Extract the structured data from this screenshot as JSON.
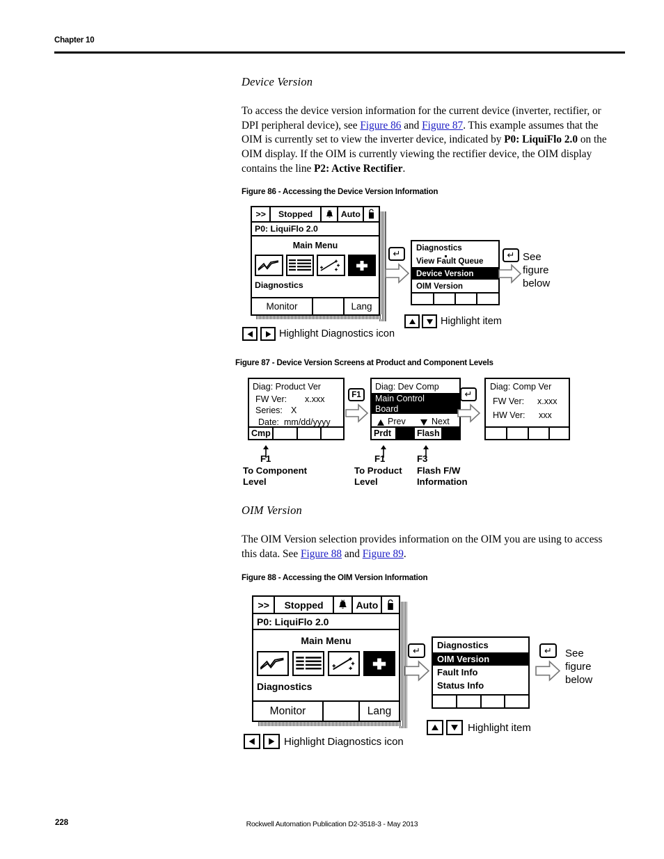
{
  "page": {
    "chapter": "Chapter 10",
    "page_number": "228",
    "publication": "Rockwell Automation Publication D2-3518-3 - May 2013"
  },
  "sections": {
    "device_version": {
      "heading": "Device Version",
      "paragraph_parts": [
        {
          "t": "To access the device version information for the current device (inverter, rectifier, or DPI peripheral device), see "
        },
        {
          "t": "Figure 86",
          "style": "link"
        },
        {
          "t": " and "
        },
        {
          "t": "Figure 87",
          "style": "link"
        },
        {
          "t": ". This example assumes that the OIM is currently set to view the inverter device, indicated by "
        },
        {
          "t": "P0: LiquiFlo 2.0",
          "style": "bold"
        },
        {
          "t": " on the OIM display. If the OIM is currently viewing the rectifier device, the OIM display contains the line "
        },
        {
          "t": "P2: Active Rectifier",
          "style": "bold"
        },
        {
          "t": "."
        }
      ]
    },
    "oim_version": {
      "heading": "OIM Version",
      "paragraph_parts": [
        {
          "t": "The OIM Version selection provides information on the OIM you are using to access this data. See "
        },
        {
          "t": "Figure 88",
          "style": "link"
        },
        {
          "t": " and "
        },
        {
          "t": "Figure 89",
          "style": "link"
        },
        {
          "t": "."
        }
      ]
    }
  },
  "figures": {
    "fig86": {
      "caption": "Figure 86 - Accessing the Device Version Information",
      "oim": {
        "statusbar": {
          "prev": ">>",
          "state": "Stopped",
          "alarm_icon": "bell-icon",
          "mode": "Auto",
          "lock_icon": "lock-icon"
        },
        "device_line": "P0: LiquiFlo 2.0",
        "menu_title": "Main Menu",
        "icons": [
          "trend-waveform-icon",
          "list-table-icon",
          "scatter-plot-icon",
          "diagnostics-plus-icon"
        ],
        "selected_icon_index": 3,
        "selection_label": "Diagnostics",
        "softkeys": [
          "Monitor",
          "",
          "Lang"
        ]
      },
      "enter_key": "↵",
      "menu": {
        "title": "Diagnostics",
        "items": [
          {
            "label": "View Fault Queue",
            "highlighted": false
          },
          {
            "label": "Device Version",
            "highlighted": true
          },
          {
            "label": "OIM Version",
            "highlighted": false
          }
        ]
      },
      "see_figure_below": "See\nfigure\nbelow",
      "hint_left": "Highlight Diagnostics icon",
      "hint_right": "Highlight item",
      "left_arrow_icon": "left-triangle-icon",
      "right_arrow_icon": "right-triangle-icon",
      "up_arrow_icon": "up-triangle-icon",
      "down_arrow_icon": "down-triangle-icon"
    },
    "fig87": {
      "caption": "Figure 87 - Device Version Screens at Product and Component Levels",
      "panels": [
        {
          "title": "Diag: Product Ver",
          "lines": [
            {
              "label": "FW Ver:",
              "value": "x.xxx"
            },
            {
              "label": "Series:",
              "value": "X"
            },
            {
              "label": "Date:",
              "value": "mm/dd/yyyy"
            }
          ],
          "highlight": null,
          "softkeys": [
            "Cmp",
            "",
            "",
            ""
          ]
        },
        {
          "title": "Diag: Dev Comp",
          "highlight": "Main Control\nBoard",
          "nav_prev": "Prev",
          "nav_next": "Next",
          "prev_icon": "up-triangle-icon",
          "next_icon": "down-triangle-icon",
          "softkeys": [
            "Prdt",
            "Flash",
            "",
            ""
          ]
        },
        {
          "title": "Diag: Comp Ver",
          "lines": [
            {
              "label": "FW Ver:",
              "value": "x.xxx"
            },
            {
              "label": "HW Ver:",
              "value": "xxx"
            }
          ],
          "highlight": null,
          "softkeys": [
            "",
            "",
            "",
            ""
          ]
        }
      ],
      "transitions": [
        {
          "key": "F1"
        },
        {
          "key": "↵"
        }
      ],
      "callouts": [
        {
          "key": "F1",
          "text": "To Component\nLevel"
        },
        {
          "key": "F1",
          "text": "To Product\nLevel"
        },
        {
          "key": "F3",
          "text": "Flash F/W\nInformation"
        }
      ]
    },
    "fig88": {
      "caption": "Figure 88 - Accessing the OIM Version Information",
      "oim": {
        "statusbar": {
          "prev": ">>",
          "state": "Stopped",
          "alarm_icon": "bell-icon",
          "mode": "Auto",
          "lock_icon": "lock-icon"
        },
        "device_line": "P0: LiquiFlo 2.0",
        "menu_title": "Main Menu",
        "icons": [
          "trend-waveform-icon",
          "list-table-icon",
          "scatter-plot-icon",
          "diagnostics-plus-icon"
        ],
        "selected_icon_index": 3,
        "selection_label": "Diagnostics",
        "softkeys": [
          "Monitor",
          "",
          "Lang"
        ]
      },
      "enter_key": "↵",
      "menu": {
        "title": "Diagnostics",
        "items": [
          {
            "label": "OIM Version",
            "highlighted": true
          },
          {
            "label": "Fault Info",
            "highlighted": false
          },
          {
            "label": "Status Info",
            "highlighted": false
          }
        ]
      },
      "see_figure_below": "See\nfigure\nbelow",
      "hint_left": "Highlight Diagnostics icon",
      "hint_right": "Highlight item",
      "left_arrow_icon": "left-triangle-icon",
      "right_arrow_icon": "right-triangle-icon",
      "up_arrow_icon": "up-triangle-icon",
      "down_arrow_icon": "down-triangle-icon"
    }
  }
}
